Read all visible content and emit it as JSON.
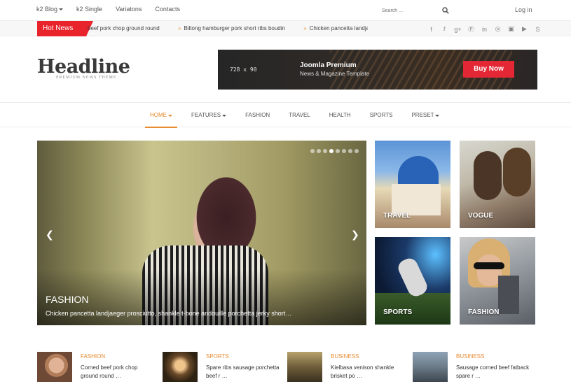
{
  "topnav": {
    "items": [
      "k2 Blog",
      "k2 Single",
      "Variatons",
      "Contacts"
    ],
    "search_placeholder": "Search ...",
    "login": "Log in"
  },
  "ticker": {
    "label": "Hot News",
    "items": [
      "beef pork chop ground round",
      "Biltong hamburger pork short ribs boudin",
      "Chicken pancetta landja"
    ],
    "social_icons": [
      "facebook-icon",
      "twitter-icon",
      "google-plus-icon",
      "pinterest-icon",
      "linkedin-icon",
      "dribbble-icon",
      "flickr-icon",
      "youtube-icon",
      "skype-icon"
    ]
  },
  "logo": {
    "name": "Headline",
    "tagline": "PREMIUM NEWS THEME"
  },
  "banner": {
    "size": "728 x 90",
    "title": "Joomla Premium",
    "subtitle": "News & Magazine Template",
    "cta": "Buy Now",
    "cta_color": "#e32734"
  },
  "mainnav": {
    "items": [
      "HOME",
      "FEATURES",
      "FASHION",
      "TRAVEL",
      "HEALTH",
      "SPORTS",
      "PRESET"
    ],
    "accent": "#e88a2e"
  },
  "slider": {
    "category": "FASHION",
    "caption": "Chicken pancetta landjaeger prosciutto, shankle t-bone andouille porchetta jerky short…",
    "dots": 8,
    "active_dot": 3
  },
  "tiles": [
    "TRAVEL",
    "VOGUE",
    "SPORTS",
    "FASHION"
  ],
  "articles": [
    {
      "category": "FASHION",
      "text": "Corned beef pork chop ground round …"
    },
    {
      "category": "SPORTS",
      "text": "Spare ribs sausage porchetta beef r …"
    },
    {
      "category": "BUSINESS",
      "text": "Kielbasa venison shankle brisket po …"
    },
    {
      "category": "BUSINESS",
      "text": "Sausage corned beef fatback spare r …"
    }
  ]
}
